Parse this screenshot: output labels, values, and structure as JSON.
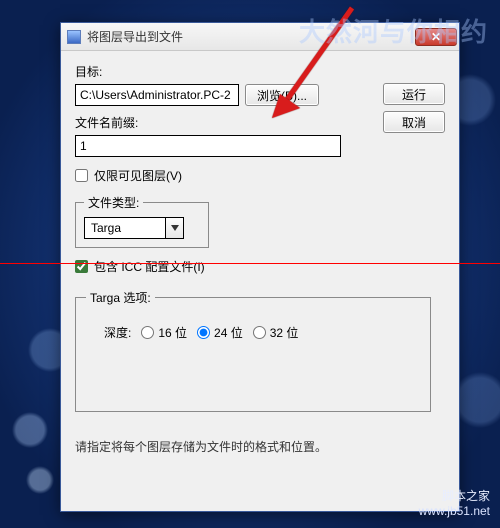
{
  "window": {
    "title": "将图层导出到文件"
  },
  "labels": {
    "destination": "目标:",
    "prefix": "文件名前缀:",
    "visibleOnly": "仅限可见图层(V)",
    "fileType": "文件类型:",
    "includeICC": "包含 ICC 配置文件(I)",
    "targaOptions": "Targa 选项:",
    "depth": "深度:"
  },
  "values": {
    "destination": "C:\\Users\\Administrator.PC-2",
    "prefix": "1",
    "fileType": "Targa",
    "visibleOnlyChecked": false,
    "includeICCChecked": true
  },
  "buttons": {
    "browse": "浏览(B)...",
    "run": "运行",
    "cancel": "取消"
  },
  "radios": {
    "d16": "16 位",
    "d24": "24 位",
    "d32": "32 位",
    "selected": "24"
  },
  "hint": "请指定将每个图层存储为文件时的格式和位置。",
  "watermark": {
    "top": "大然河与你相约",
    "bottomLine1": "脚本之家",
    "bottomLine2": "www.jb51.net"
  }
}
